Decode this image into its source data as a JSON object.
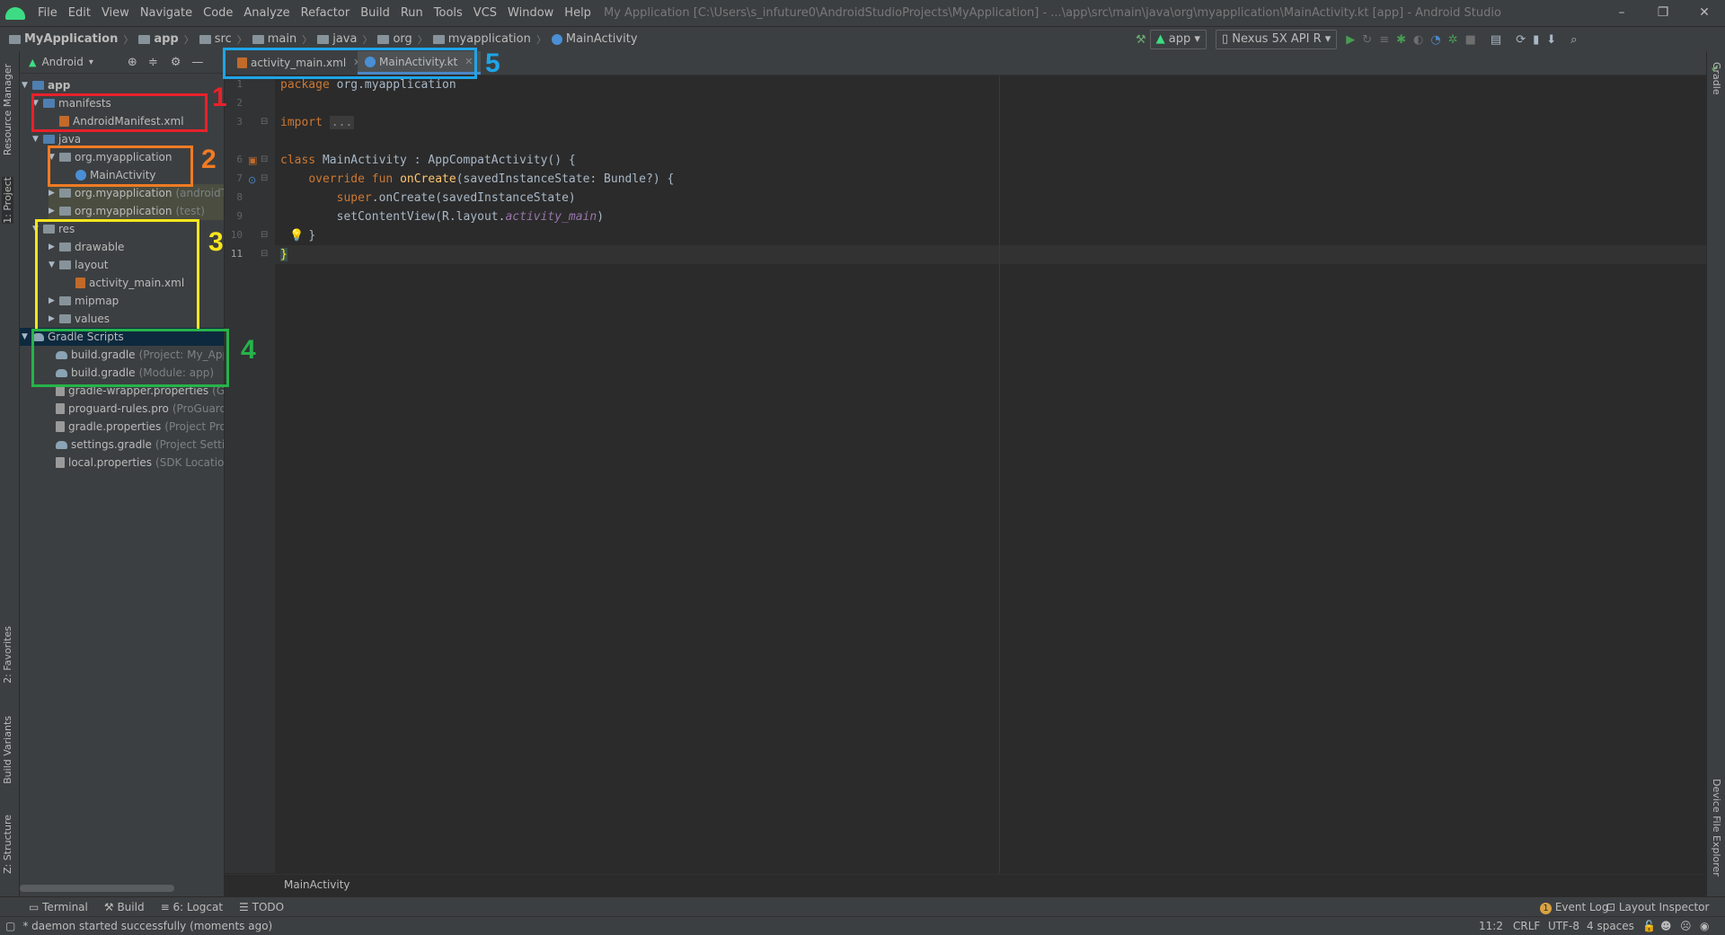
{
  "app": {
    "menu": [
      "File",
      "Edit",
      "View",
      "Navigate",
      "Code",
      "Analyze",
      "Refactor",
      "Build",
      "Run",
      "Tools",
      "VCS",
      "Window",
      "Help"
    ],
    "window_title": "My Application [C:\\Users\\s_infuture0\\AndroidStudioProjects\\MyApplication] - ...\\app\\src\\main\\java\\org\\myapplication\\MainActivity.kt [app] - Android Studio",
    "window_controls": [
      "–",
      "❐",
      "✕"
    ]
  },
  "navbar": {
    "crumbs": [
      "MyApplication",
      "app",
      "src",
      "main",
      "java",
      "org",
      "myapplication",
      "MainActivity"
    ],
    "run_config": "app",
    "device": "Nexus 5X API R"
  },
  "sidebar_left": {
    "tabs": [
      "Resource Manager",
      "1: Project",
      "2: Favorites",
      "Build Variants",
      "Z: Structure"
    ]
  },
  "sidebar_right": {
    "tabs": [
      "Gradle",
      "Device File Explorer"
    ]
  },
  "project": {
    "view_mode": "Android",
    "tree": [
      {
        "label": "app",
        "hint": ""
      },
      {
        "label": "manifests",
        "hint": ""
      },
      {
        "label": "AndroidManifest.xml",
        "hint": ""
      },
      {
        "label": "java",
        "hint": ""
      },
      {
        "label": "org.myapplication",
        "hint": ""
      },
      {
        "label": "MainActivity",
        "hint": ""
      },
      {
        "label": "org.myapplication",
        "hint": "(androidTest)"
      },
      {
        "label": "org.myapplication",
        "hint": "(test)"
      },
      {
        "label": "res",
        "hint": ""
      },
      {
        "label": "drawable",
        "hint": ""
      },
      {
        "label": "layout",
        "hint": ""
      },
      {
        "label": "activity_main.xml",
        "hint": ""
      },
      {
        "label": "mipmap",
        "hint": ""
      },
      {
        "label": "values",
        "hint": ""
      },
      {
        "label": "Gradle Scripts",
        "hint": ""
      },
      {
        "label": "build.gradle",
        "hint": "(Project: My_Application)"
      },
      {
        "label": "build.gradle",
        "hint": "(Module: app)"
      },
      {
        "label": "gradle-wrapper.properties",
        "hint": "(Gradle Version)"
      },
      {
        "label": "proguard-rules.pro",
        "hint": "(ProGuard Rules for app)"
      },
      {
        "label": "gradle.properties",
        "hint": "(Project Properties)"
      },
      {
        "label": "settings.gradle",
        "hint": "(Project Settings)"
      },
      {
        "label": "local.properties",
        "hint": "(SDK Location)"
      }
    ]
  },
  "editor": {
    "tabs": [
      "activity_main.xml",
      "MainActivity.kt"
    ],
    "line_numbers": [
      "1",
      "2",
      "3",
      "6",
      "7",
      "8",
      "9",
      "10",
      "11"
    ],
    "code": {
      "l1_kw": "package",
      "l1_rest": " org.myapplication",
      "l3_kw": "import",
      "l3_fold": "...",
      "l6_kw": "class",
      "l6_rest": " MainActivity : AppCompatActivity() {",
      "l7_kw": "override fun",
      "l7_fn": "onCreate",
      "l7_rest": "(savedInstanceState: Bundle?) {",
      "l8_kw": "super",
      "l8_rest": ".onCreate(savedInstanceState)",
      "l9_rest": "setContentView(R.layout.",
      "l9_it": "activity_main",
      "l9_end": ")",
      "l10": "}",
      "l11": "}"
    },
    "breadcrumb": "MainActivity"
  },
  "bottom": {
    "tool_windows": [
      "Terminal",
      "Build",
      "6: Logcat",
      "TODO"
    ],
    "right_tools": [
      "Event Log",
      "Layout Inspector"
    ],
    "event_count": "1",
    "status_message": "* daemon started successfully (moments ago)",
    "cursor": "11:2",
    "line_sep": "CRLF",
    "encoding": "UTF-8",
    "indent": "4 spaces"
  },
  "annotations": [
    "1",
    "2",
    "3",
    "4",
    "5"
  ],
  "annotation_colors": {
    "1": "#e8212b",
    "2": "#f07b24",
    "3": "#f7e51d",
    "4": "#26b34a",
    "5": "#1ea5e8"
  }
}
